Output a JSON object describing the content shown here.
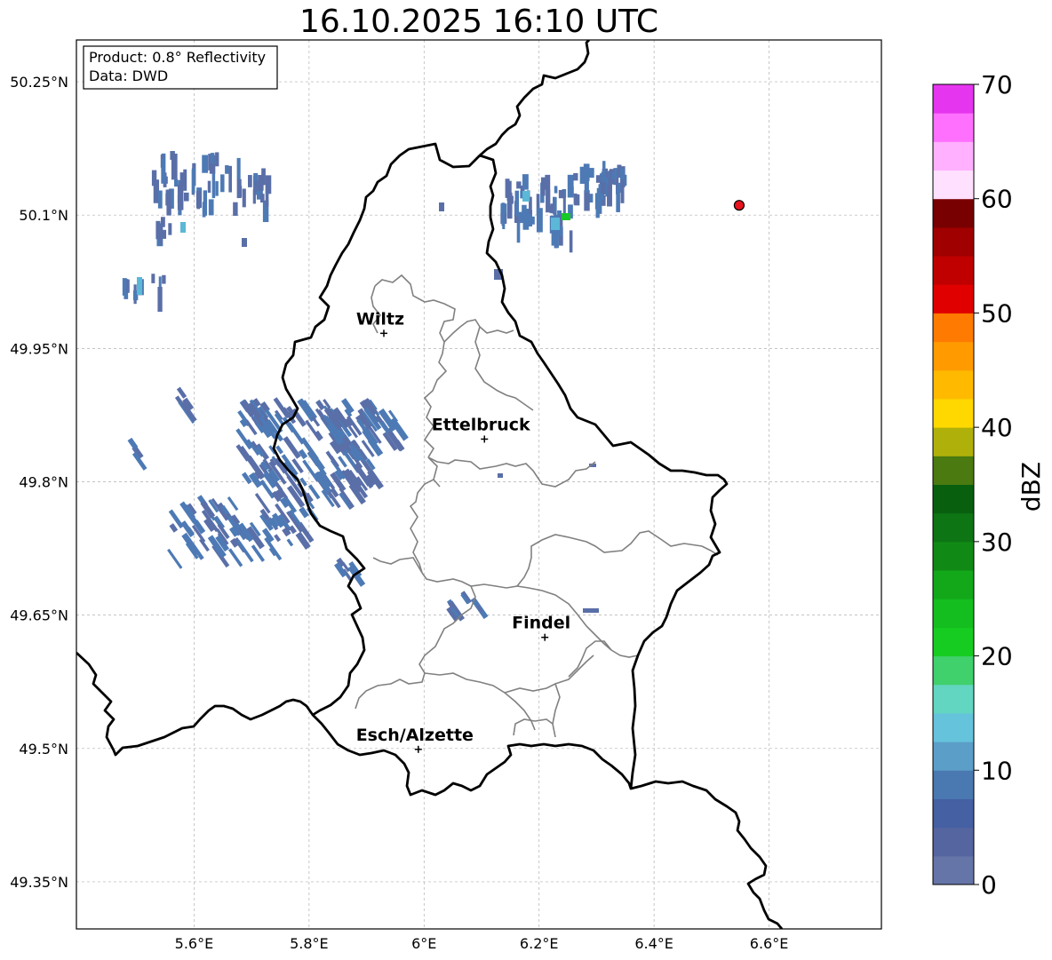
{
  "title": "16.10.2025 16:10 UTC",
  "info_box": {
    "product": "Product: 0.8° Reflectivity",
    "source": "Data: DWD"
  },
  "axes": {
    "lon_ticks": [
      {
        "value": 5.6,
        "label": "5.6°E"
      },
      {
        "value": 5.8,
        "label": "5.8°E"
      },
      {
        "value": 6.0,
        "label": "6°E"
      },
      {
        "value": 6.2,
        "label": "6.2°E"
      },
      {
        "value": 6.4,
        "label": "6.4°E"
      },
      {
        "value": 6.6,
        "label": "6.6°E"
      }
    ],
    "lat_ticks": [
      {
        "value": 50.25,
        "label": "50.25°N"
      },
      {
        "value": 50.1,
        "label": "50.1°N"
      },
      {
        "value": 49.95,
        "label": "49.95°N"
      },
      {
        "value": 49.8,
        "label": "49.8°N"
      },
      {
        "value": 49.65,
        "label": "49.65°N"
      },
      {
        "value": 49.5,
        "label": "49.5°N"
      },
      {
        "value": 49.35,
        "label": "49.35°N"
      }
    ],
    "lon_range": [
      5.4,
      6.8
    ],
    "lat_range": [
      49.3,
      50.3
    ]
  },
  "cities": [
    {
      "name": "Wiltz",
      "lon": 5.93,
      "lat": 49.967
    },
    {
      "name": "Ettelbruck",
      "lon": 6.105,
      "lat": 49.848
    },
    {
      "name": "Findel",
      "lon": 6.21,
      "lat": 49.625
    },
    {
      "name": "Esch/Alzette",
      "lon": 5.99,
      "lat": 49.499
    }
  ],
  "radar_site": {
    "lon": 6.548,
    "lat": 50.111,
    "color": "#e8141e"
  },
  "colorbar": {
    "label": "dBZ",
    "min": 0,
    "max": 70,
    "ticks": [
      {
        "value": 0,
        "label": "0"
      },
      {
        "value": 10,
        "label": "10"
      },
      {
        "value": 20,
        "label": "20"
      },
      {
        "value": 30,
        "label": "30"
      },
      {
        "value": 40,
        "label": "40"
      },
      {
        "value": 50,
        "label": "50"
      },
      {
        "value": 60,
        "label": "60"
      },
      {
        "value": 70,
        "label": "70"
      }
    ],
    "colors": [
      "#6675a8",
      "#5565a0",
      "#4560a3",
      "#4a78b0",
      "#5b9ec8",
      "#65c3dc",
      "#62d6c0",
      "#40d06c",
      "#16cc20",
      "#14be1e",
      "#12a81a",
      "#118a15",
      "#0e7514",
      "#08600f",
      "#4a7a10",
      "#b0b00a",
      "#ffd800",
      "#ffba00",
      "#ff9a00",
      "#ff7a00",
      "#e00000",
      "#c00000",
      "#a00000",
      "#780000",
      "#ffe0ff",
      "#ffb0ff",
      "#ff70ff",
      "#e535ef"
    ]
  },
  "precip_colors": {
    "light": "#5a6fa8",
    "medium": "#4d7ab5",
    "cyan": "#5bb8d6",
    "green": "#18c828"
  }
}
